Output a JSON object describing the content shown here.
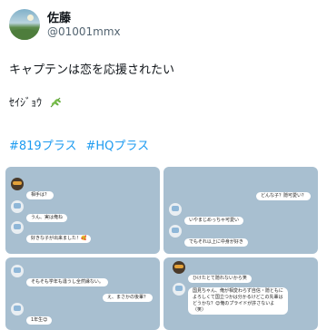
{
  "profile": {
    "name": "佐藤",
    "handle": "@01001mmx"
  },
  "tweet": {
    "text": "キャプテンは恋を応援されたい",
    "signature": "ｾｲｼﾞｮｳ",
    "hashtags": [
      "#819プラス",
      "#HQプラス"
    ]
  },
  "panels": {
    "p1": {
      "m1": {
        "text": "相手は？"
      },
      "m2": {
        "text": "うん、実は俺ね"
      },
      "m3": {
        "text": "好きな子が出来ました！🥰"
      }
    },
    "p2": {
      "m1": {
        "text": "どんな子？隠可愛い？"
      },
      "m2": {
        "text": "いやまじめっちゃ可愛い"
      },
      "m3": {
        "text": "でもそれ以上に中身が好き"
      }
    },
    "p3": {
      "m1": {
        "text": "そもそも学年も違うし全然縁ない。"
      },
      "m2": {
        "text": "え、まさかの後輩？"
      },
      "m3": {
        "text": "1年生😊"
      }
    },
    "p4": {
      "m1": {
        "text": "ひけたとて隠れないから笑"
      },
      "m2": {
        "text": "国見ちゃん、俺が相変わらず自信・隠ともによろしくて国立つかは分かるけどこの先輩はどうかな？😊俺のプライドが許さないよ（笑）"
      }
    }
  }
}
